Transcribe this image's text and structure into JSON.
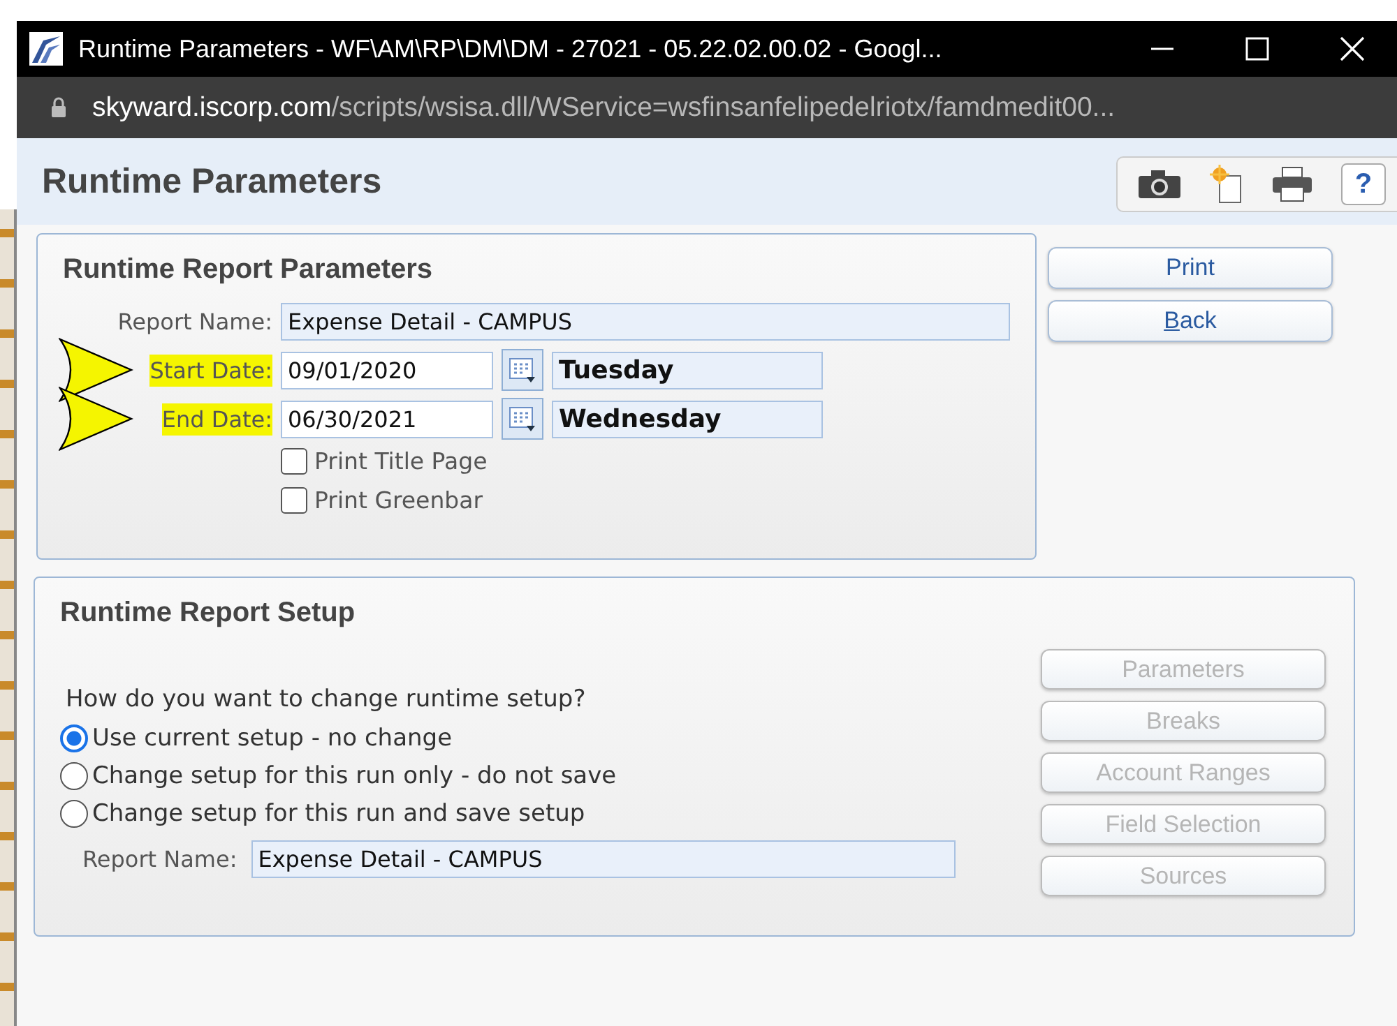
{
  "window": {
    "title": "Runtime Parameters - WF\\AM\\RP\\DM\\DM - 27021 - 05.22.02.00.02 - Googl..."
  },
  "address_bar": {
    "host": "skyward.iscorp.com",
    "path": "/scripts/wsisa.dll/WService=wsfinsanfelipedelriotx/famdmedit00..."
  },
  "page": {
    "title": "Runtime Parameters",
    "help": "?"
  },
  "parameters": {
    "title": "Runtime Report Parameters",
    "fields": [
      {
        "kind": "text",
        "label": "Report Name:",
        "value": "Expense Detail - CAMPUS",
        "highlighted": false
      },
      {
        "kind": "date",
        "label": "Start Date:",
        "value": "09/01/2020",
        "day": "Tuesday",
        "highlighted": true
      },
      {
        "kind": "date",
        "label": "End Date:",
        "value": "06/30/2021",
        "day": "Wednesday",
        "highlighted": true
      }
    ],
    "checkboxes": [
      {
        "label": "Print Title Page",
        "checked": false
      },
      {
        "label": "Print Greenbar",
        "checked": false
      }
    ]
  },
  "actions": [
    {
      "label": "Print",
      "mnemonic": false
    },
    {
      "label": "Back",
      "mnemonic": true
    }
  ],
  "setup": {
    "title": "Runtime Report Setup",
    "question": "How do you want to change runtime setup?",
    "options": [
      {
        "label": "Use current setup - no change",
        "selected": true
      },
      {
        "label": "Change setup for this run only - do not save",
        "selected": false
      },
      {
        "label": "Change setup for this run and save setup",
        "selected": false
      }
    ],
    "report_name": {
      "label": "Report Name:",
      "value": "Expense Detail - CAMPUS"
    },
    "buttons": [
      {
        "label": "Parameters",
        "disabled": true
      },
      {
        "label": "Breaks",
        "disabled": true
      },
      {
        "label": "Account Ranges",
        "disabled": true
      },
      {
        "label": "Field Selection",
        "disabled": true
      },
      {
        "label": "Sources",
        "disabled": true
      }
    ]
  }
}
